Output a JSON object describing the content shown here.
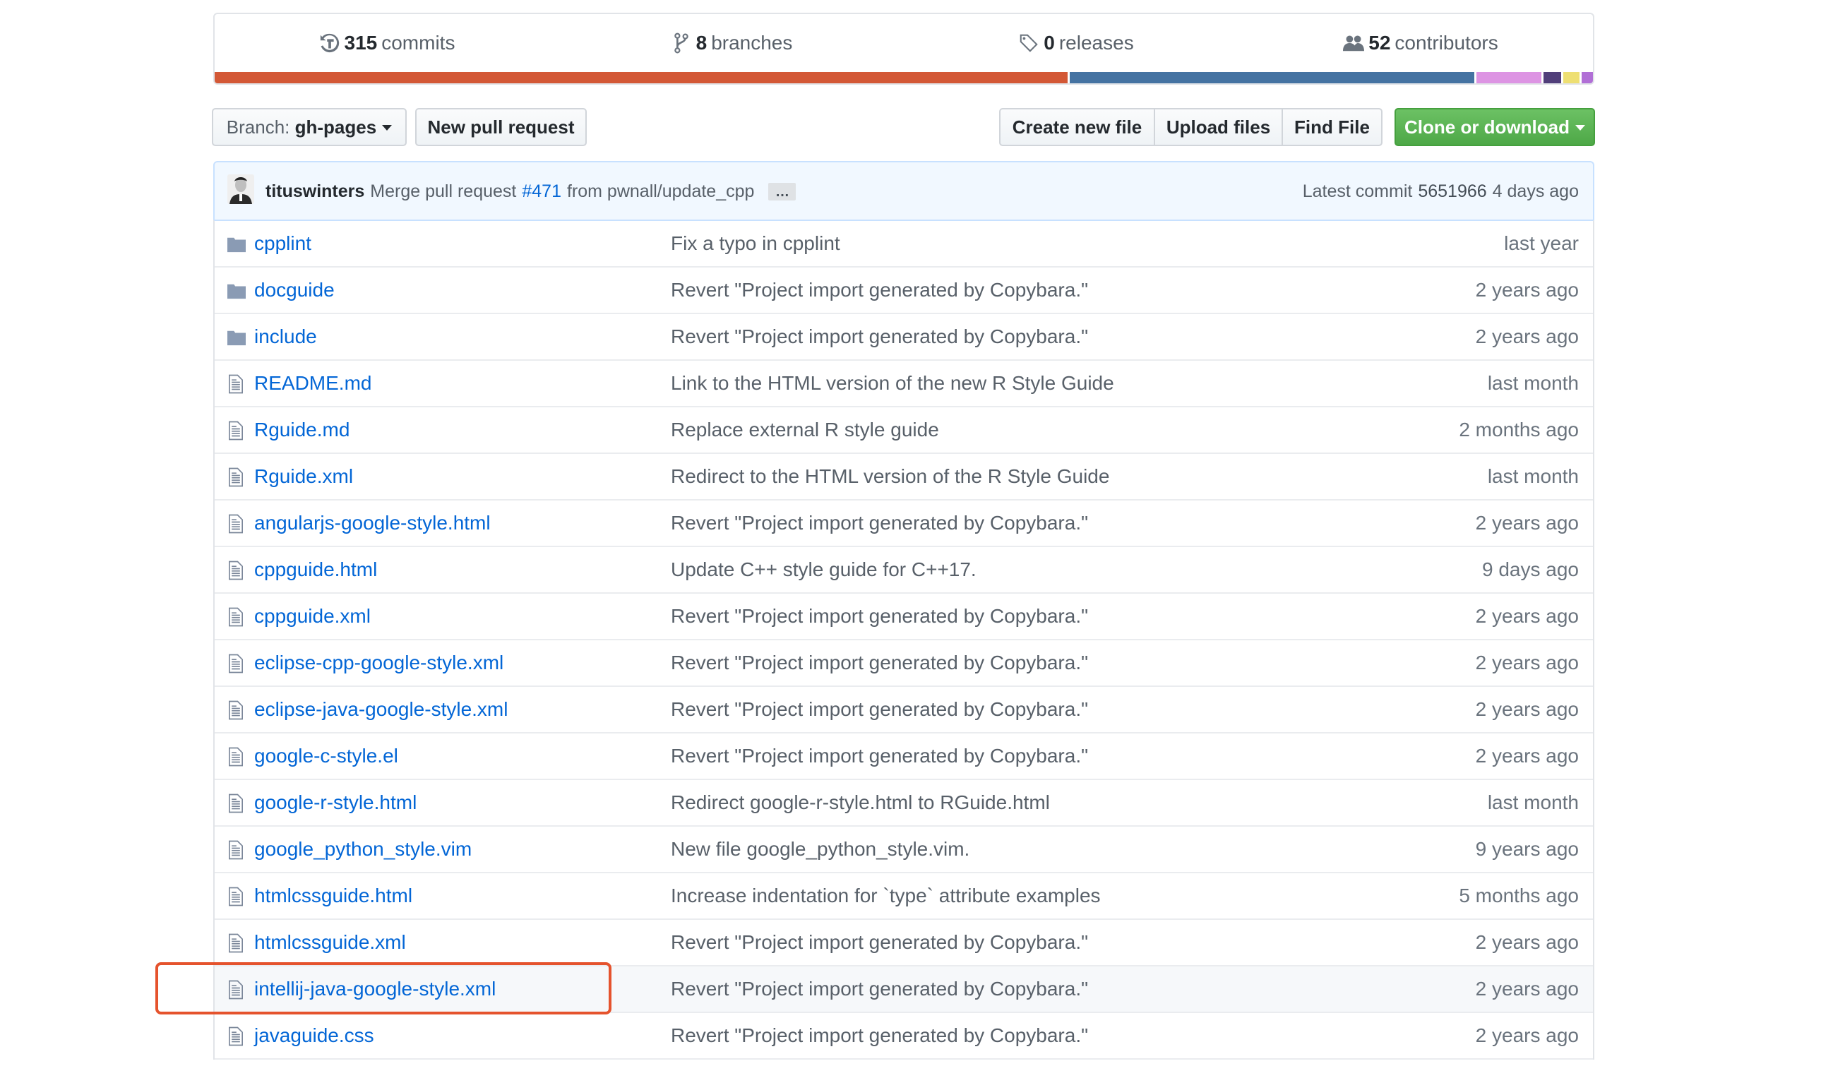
{
  "summary": {
    "stats": [
      {
        "icon": "history-icon",
        "count": "315",
        "label": "commits"
      },
      {
        "icon": "git-branch-icon",
        "count": "8",
        "label": "branches"
      },
      {
        "icon": "tag-icon",
        "count": "0",
        "label": "releases"
      },
      {
        "icon": "people-icon",
        "count": "52",
        "label": "contributors"
      }
    ],
    "languages": [
      {
        "percent": 62.0,
        "color": "#d35836"
      },
      {
        "percent": 29.4,
        "color": "#4573a2"
      },
      {
        "percent": 4.7,
        "color": "#dd94e3"
      },
      {
        "percent": 1.3,
        "color": "#513f7a"
      },
      {
        "percent": 1.2,
        "color": "#eedf72"
      },
      {
        "percent": 0.8,
        "color": "#b16fd6"
      }
    ]
  },
  "toolbar": {
    "branch_prefix": "Branch:",
    "branch_name": "gh-pages",
    "new_pull_request": "New pull request",
    "create_new_file": "Create new file",
    "upload_files": "Upload files",
    "find_file": "Find File",
    "clone_or_download": "Clone or download"
  },
  "commit": {
    "author": "tituswinters",
    "message_prefix": "Merge pull request",
    "issue": "#471",
    "message_suffix": "from pwnall/update_cpp",
    "ellipsis": "…",
    "latest_label": "Latest commit",
    "sha": "5651966",
    "age": "4 days ago"
  },
  "files": [
    {
      "type": "dir",
      "name": "cpplint",
      "message": "Fix a typo in cpplint",
      "age": "last year"
    },
    {
      "type": "dir",
      "name": "docguide",
      "message": "Revert \"Project import generated by Copybara.\"",
      "age": "2 years ago"
    },
    {
      "type": "dir",
      "name": "include",
      "message": "Revert \"Project import generated by Copybara.\"",
      "age": "2 years ago"
    },
    {
      "type": "file",
      "name": "README.md",
      "message": "Link to the HTML version of the new R Style Guide",
      "age": "last month"
    },
    {
      "type": "file",
      "name": "Rguide.md",
      "message": "Replace external R style guide",
      "age": "2 months ago"
    },
    {
      "type": "file",
      "name": "Rguide.xml",
      "message": "Redirect to the HTML version of the R Style Guide",
      "age": "last month"
    },
    {
      "type": "file",
      "name": "angularjs-google-style.html",
      "message": "Revert \"Project import generated by Copybara.\"",
      "age": "2 years ago"
    },
    {
      "type": "file",
      "name": "cppguide.html",
      "message": "Update C++ style guide for C++17.",
      "age": "9 days ago"
    },
    {
      "type": "file",
      "name": "cppguide.xml",
      "message": "Revert \"Project import generated by Copybara.\"",
      "age": "2 years ago"
    },
    {
      "type": "file",
      "name": "eclipse-cpp-google-style.xml",
      "message": "Revert \"Project import generated by Copybara.\"",
      "age": "2 years ago"
    },
    {
      "type": "file",
      "name": "eclipse-java-google-style.xml",
      "message": "Revert \"Project import generated by Copybara.\"",
      "age": "2 years ago"
    },
    {
      "type": "file",
      "name": "google-c-style.el",
      "message": "Revert \"Project import generated by Copybara.\"",
      "age": "2 years ago"
    },
    {
      "type": "file",
      "name": "google-r-style.html",
      "message": "Redirect google-r-style.html to RGuide.html",
      "age": "last month"
    },
    {
      "type": "file",
      "name": "google_python_style.vim",
      "message": "New file google_python_style.vim.",
      "age": "9 years ago"
    },
    {
      "type": "file",
      "name": "htmlcssguide.html",
      "message": "Increase indentation for `type` attribute examples",
      "age": "5 months ago"
    },
    {
      "type": "file",
      "name": "htmlcssguide.xml",
      "message": "Revert \"Project import generated by Copybara.\"",
      "age": "2 years ago"
    },
    {
      "type": "file",
      "name": "intellij-java-google-style.xml",
      "message": "Revert \"Project import generated by Copybara.\"",
      "age": "2 years ago",
      "highlighted": true
    },
    {
      "type": "file",
      "name": "javaguide.css",
      "message": "Revert \"Project import generated by Copybara.\"",
      "age": "2 years ago"
    }
  ],
  "annotation": {
    "color": "#e5532d",
    "target": "intellij-java-google-style.xml"
  }
}
